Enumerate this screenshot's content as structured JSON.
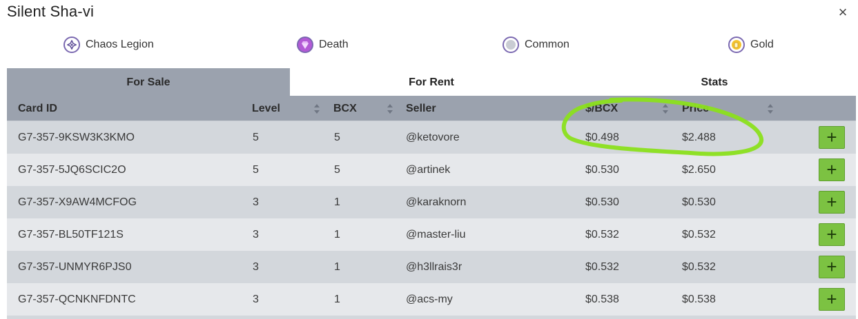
{
  "modal": {
    "title": "Silent Sha-vi",
    "close_glyph": "×"
  },
  "meta": [
    {
      "label": "Chaos Legion",
      "icon": "chaos-legion-icon"
    },
    {
      "label": "Death",
      "icon": "death-icon"
    },
    {
      "label": "Common",
      "icon": "common-rarity-icon"
    },
    {
      "label": "Gold",
      "icon": "gold-foil-icon"
    }
  ],
  "tabs": [
    {
      "label": "For Sale",
      "active": true
    },
    {
      "label": "For Rent",
      "active": false
    },
    {
      "label": "Stats",
      "active": false
    }
  ],
  "table": {
    "columns": {
      "card_id": "Card ID",
      "level": "Level",
      "bcx": "BCX",
      "seller": "Seller",
      "price_per_bcx": "$/BCX",
      "price": "Price"
    },
    "add_glyph": "+",
    "rows": [
      {
        "card_id": "G7-357-9KSW3K3KMO",
        "level": "5",
        "bcx": "5",
        "seller": "@ketovore",
        "price_per_bcx": "$0.498",
        "price": "$2.488"
      },
      {
        "card_id": "G7-357-5JQ6SCIC2O",
        "level": "5",
        "bcx": "5",
        "seller": "@artinek",
        "price_per_bcx": "$0.530",
        "price": "$2.650"
      },
      {
        "card_id": "G7-357-X9AW4MCFOG",
        "level": "3",
        "bcx": "1",
        "seller": "@karaknorn",
        "price_per_bcx": "$0.530",
        "price": "$0.530"
      },
      {
        "card_id": "G7-357-BL50TF121S",
        "level": "3",
        "bcx": "1",
        "seller": "@master-liu",
        "price_per_bcx": "$0.532",
        "price": "$0.532"
      },
      {
        "card_id": "G7-357-UNMYR6PJS0",
        "level": "3",
        "bcx": "1",
        "seller": "@h3llrais3r",
        "price_per_bcx": "$0.532",
        "price": "$0.532"
      },
      {
        "card_id": "G7-357-QCNKNFDNTC",
        "level": "3",
        "bcx": "1",
        "seller": "@acs-my",
        "price_per_bcx": "$0.538",
        "price": "$0.538"
      }
    ]
  },
  "colors": {
    "header_bg": "#9ba2ae",
    "row_odd": "#d3d7dc",
    "row_even": "#e6e8eb",
    "add_button": "#7cc242",
    "annotation": "#8be01c"
  }
}
